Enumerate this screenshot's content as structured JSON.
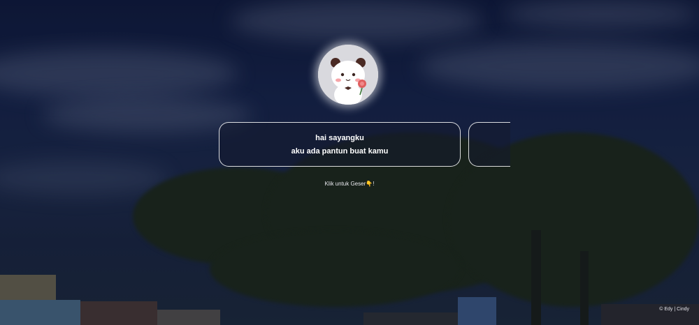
{
  "slider": {
    "cards": [
      {
        "line1": "hai sayangku",
        "line2": "aku ada pantun buat kamu"
      }
    ],
    "hint_text": "Klik untuk Geser",
    "hint_icon": "pointing-hand-icon",
    "hint_suffix": "!"
  },
  "footer": {
    "credit": "© Edy | Cindy"
  },
  "colors": {
    "card_border": "#ffffff",
    "avatar_bg": "#f1f1f4",
    "hand": "#f0c23c"
  }
}
